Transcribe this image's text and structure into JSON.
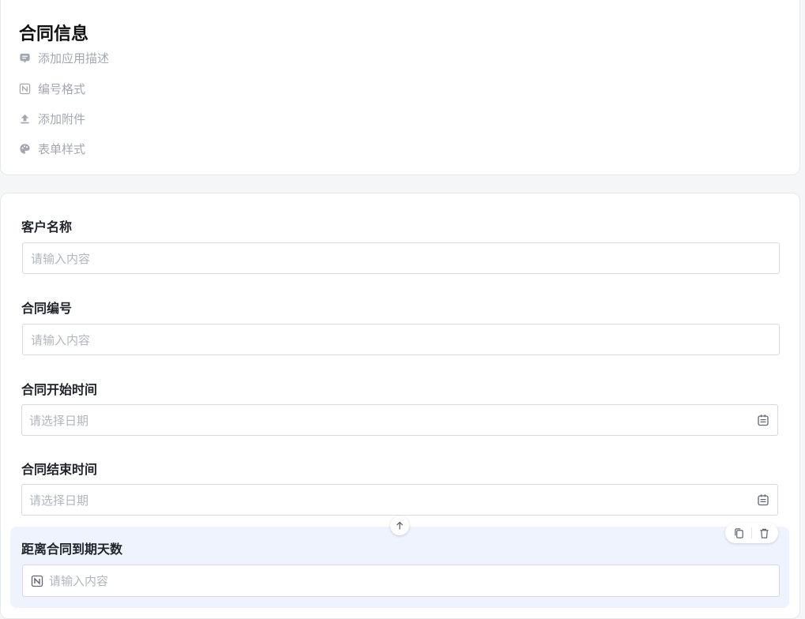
{
  "form": {
    "title": "合同信息",
    "meta_items": [
      {
        "label": "添加应用描述",
        "icon": "comment-icon"
      },
      {
        "label": "编号格式",
        "icon": "number-format-icon"
      },
      {
        "label": "添加附件",
        "icon": "upload-icon"
      },
      {
        "label": "表单样式",
        "icon": "palette-icon"
      }
    ]
  },
  "fields": {
    "customer_name": {
      "label": "客户名称",
      "placeholder": "请输入内容"
    },
    "contract_no": {
      "label": "合同编号",
      "placeholder": "请输入内容"
    },
    "start_date": {
      "label": "合同开始时间",
      "placeholder": "请选择日期"
    },
    "end_date": {
      "label": "合同结束时间",
      "placeholder": "请选择日期"
    },
    "days_left": {
      "label": "距离合同到期天数",
      "placeholder": "请输入内容"
    }
  },
  "colors": {
    "selected_bg": "#eef3fd",
    "placeholder": "#b2b6bd",
    "meta_text": "#a3a8b0"
  }
}
